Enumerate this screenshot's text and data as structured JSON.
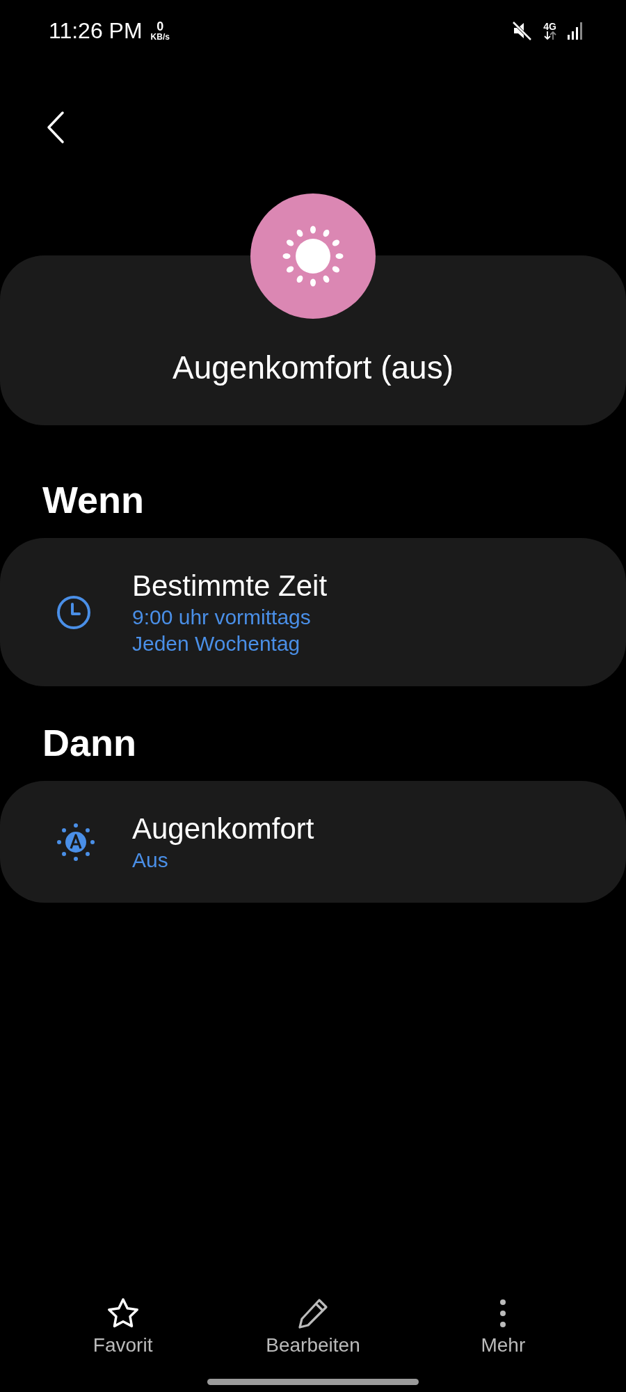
{
  "status_bar": {
    "time": "11:26 PM",
    "speed_value": "0",
    "speed_unit": "KB/s",
    "network": "4G"
  },
  "header": {
    "title": "Augenkomfort (aus)"
  },
  "sections": [
    {
      "heading": "Wenn",
      "item": {
        "kind": "clock",
        "title": "Bestimmte Zeit",
        "details": [
          "9:00 uhr vormittags",
          "Jeden Wochentag"
        ]
      }
    },
    {
      "heading": "Dann",
      "item": {
        "kind": "eye-comfort",
        "title": "Augenkomfort",
        "details": [
          "Aus"
        ]
      }
    }
  ],
  "bottom_nav": [
    {
      "kind": "star",
      "label": "Favorit"
    },
    {
      "kind": "pencil",
      "label": "Bearbeiten"
    },
    {
      "kind": "more",
      "label": "Mehr"
    }
  ]
}
